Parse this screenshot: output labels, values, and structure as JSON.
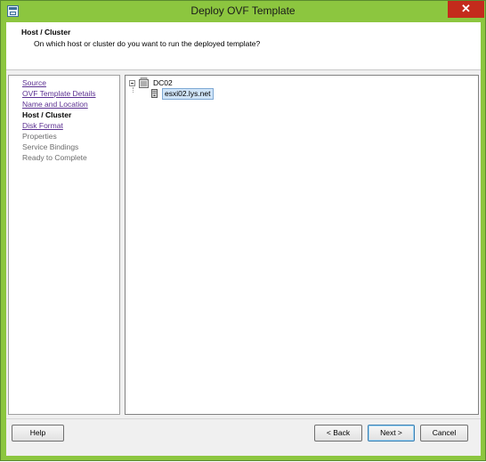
{
  "window": {
    "title": "Deploy OVF Template",
    "close_glyph": "✕"
  },
  "header": {
    "title": "Host / Cluster",
    "subtitle": "On which host or cluster do you want to run the deployed template?"
  },
  "steps": [
    {
      "label": "Source",
      "state": "done"
    },
    {
      "label": "OVF Template Details",
      "state": "done"
    },
    {
      "label": "Name and Location",
      "state": "done"
    },
    {
      "label": "Host / Cluster",
      "state": "current"
    },
    {
      "label": "Disk Format",
      "state": "done"
    },
    {
      "label": "Properties",
      "state": "pending"
    },
    {
      "label": "Service Bindings",
      "state": "pending"
    },
    {
      "label": "Ready to Complete",
      "state": "pending"
    }
  ],
  "tree": {
    "datacenter": {
      "label": "DC02",
      "icon": "datacenter-icon",
      "expanded": true
    },
    "host": {
      "label": "esxi02.lys.net",
      "icon": "host-icon",
      "selected": true
    }
  },
  "buttons": {
    "help": "Help",
    "back": "< Back",
    "next": "Next >",
    "cancel": "Cancel"
  },
  "colors": {
    "title_bar": "#8cc63f",
    "close_button": "#c42b1c",
    "link": "#5b2f91",
    "selection": "#cfe4f8"
  }
}
